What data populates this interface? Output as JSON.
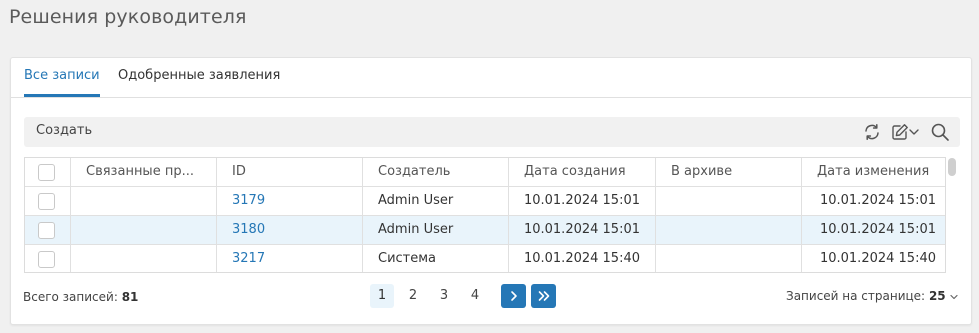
{
  "page": {
    "title": "Решения руководителя"
  },
  "tabs": [
    {
      "label": "Все записи",
      "active": true
    },
    {
      "label": "Одобренные заявления",
      "active": false
    }
  ],
  "toolbar": {
    "create_label": "Создать",
    "icons": [
      "refresh-icon",
      "edit-icon",
      "chevron-down-icon",
      "search-icon"
    ]
  },
  "grid": {
    "columns": [
      "Связанные пр...",
      "ID",
      "Создатель",
      "Дата создания",
      "В архиве",
      "Дата изменения"
    ],
    "rows": [
      {
        "related": "",
        "id": "3179",
        "creator": "Admin User",
        "created": "10.01.2024 15:01",
        "archived": "",
        "modified": "10.01.2024 15:01",
        "selected": false
      },
      {
        "related": "",
        "id": "3180",
        "creator": "Admin User",
        "created": "10.01.2024 15:01",
        "archived": "",
        "modified": "10.01.2024 15:01",
        "selected": true
      },
      {
        "related": "",
        "id": "3217",
        "creator": "Система",
        "created": "10.01.2024 15:40",
        "archived": "",
        "modified": "10.01.2024 15:40",
        "selected": false
      }
    ]
  },
  "footer": {
    "total_label": "Всего записей:",
    "total_value": "81",
    "pages": [
      "1",
      "2",
      "3",
      "4"
    ],
    "current_page": "1",
    "per_page_label": "Записей на странице:",
    "per_page_value": "25"
  },
  "colors": {
    "accent": "#2577b6",
    "selected_row": "#e9f4fb",
    "toolbar_bg": "#f1f1f1",
    "page_bg": "#f0f0f0"
  }
}
